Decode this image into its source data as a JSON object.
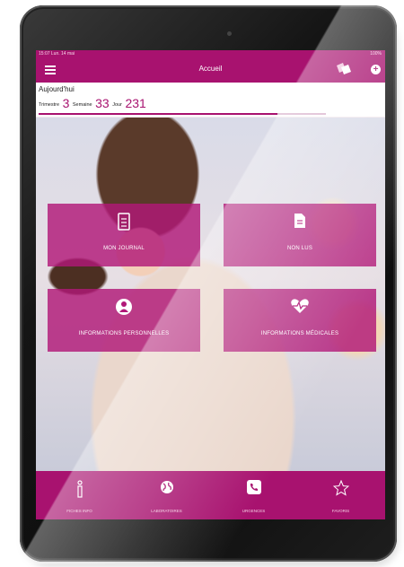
{
  "status_bar": {
    "left": "15:07  Lun. 14 mai",
    "right": "100%"
  },
  "header": {
    "title": "Accueil"
  },
  "date_panel": {
    "today_label": "Aujourd'hui",
    "trimester_label": "Trimestre",
    "trimester_value": "3",
    "week_label": "Semaine",
    "week_value": "33",
    "day_label": "Jour",
    "day_value": "231",
    "progress": 0.83
  },
  "tiles": [
    {
      "label": "MON JOURNAL",
      "icon": "journal-icon"
    },
    {
      "label": "NON LUS",
      "icon": "document-icon"
    },
    {
      "label": "INFORMATIONS PERSONNELLES",
      "icon": "person-icon"
    },
    {
      "label": "INFORMATIONS MÉDICALES",
      "icon": "heartbeat-icon"
    }
  ],
  "bottom_nav": [
    {
      "label": "FICHES INFO",
      "icon": "info-icon"
    },
    {
      "label": "LABORATOIRES",
      "icon": "globe-icon"
    },
    {
      "label": "URGENCES",
      "icon": "phone-icon"
    },
    {
      "label": "FAVORIS",
      "icon": "star-icon"
    }
  ],
  "colors": {
    "accent": "#a8126f",
    "tile": "#b11878",
    "progress_track": "#d9b3cc"
  }
}
